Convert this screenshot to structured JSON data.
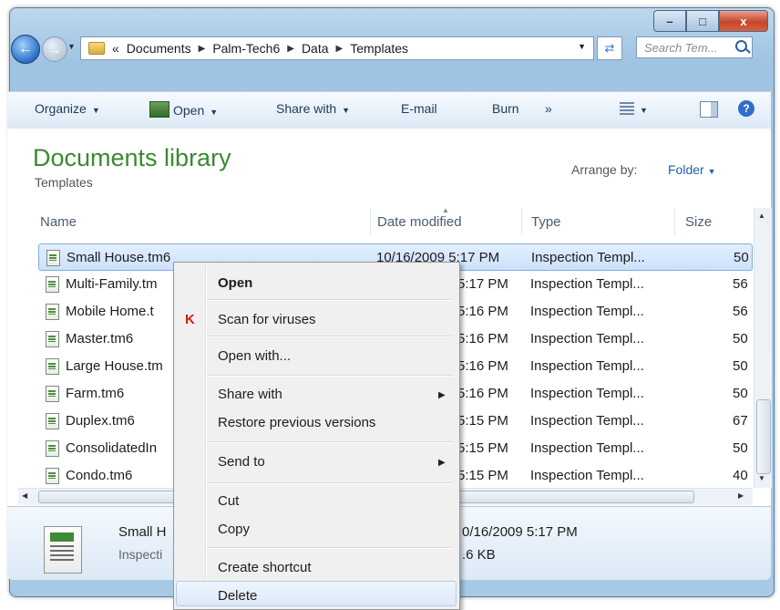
{
  "window": {
    "caption_buttons": [
      "–",
      "□",
      "x"
    ]
  },
  "address_bar": {
    "overflow": "«",
    "crumbs": [
      "Documents",
      "Palm-Tech6",
      "Data",
      "Templates"
    ],
    "search_placeholder": "Search Tem..."
  },
  "toolbar": {
    "organize": "Organize",
    "open": "Open",
    "share_with": "Share with",
    "email": "E-mail",
    "burn": "Burn",
    "more": "»"
  },
  "library": {
    "title": "Documents library",
    "subtitle": "Templates",
    "arrange_by_label": "Arrange by:",
    "arrange_by_value": "Folder"
  },
  "columns": {
    "name": "Name",
    "date": "Date modified",
    "type": "Type",
    "size": "Size"
  },
  "files": [
    {
      "name": "Small House.tm6",
      "date": "10/16/2009 5:17 PM",
      "type": "Inspection Templ...",
      "size": "50"
    },
    {
      "name": "Multi-Family.tm",
      "date": "5:17 PM",
      "type": "Inspection Templ...",
      "size": "56"
    },
    {
      "name": "Mobile Home.t",
      "date": "5:16 PM",
      "type": "Inspection Templ...",
      "size": "56"
    },
    {
      "name": "Master.tm6",
      "date": "5:16 PM",
      "type": "Inspection Templ...",
      "size": "50"
    },
    {
      "name": "Large House.tm",
      "date": "5:16 PM",
      "type": "Inspection Templ...",
      "size": "50"
    },
    {
      "name": "Farm.tm6",
      "date": "5:16 PM",
      "type": "Inspection Templ...",
      "size": "50"
    },
    {
      "name": "Duplex.tm6",
      "date": "5:15 PM",
      "type": "Inspection Templ...",
      "size": "67"
    },
    {
      "name": "ConsolidatedIn",
      "date": "5:15 PM",
      "type": "Inspection Templ...",
      "size": "50"
    },
    {
      "name": "Condo.tm6",
      "date": "5:15 PM",
      "type": "Inspection Templ...",
      "size": "40"
    }
  ],
  "details": {
    "name": "Small H",
    "type": "Inspecti",
    "date": "0/16/2009 5:17 PM",
    "size": ".6 KB"
  },
  "context_menu": {
    "open": "Open",
    "scan": "Scan for viruses",
    "open_with": "Open with...",
    "share_with": "Share with",
    "restore": "Restore previous versions",
    "send_to": "Send to",
    "cut": "Cut",
    "copy": "Copy",
    "create_shortcut": "Create shortcut",
    "delete": "Delete"
  },
  "colors": {
    "library_title": "#3a8a2f",
    "link": "#1f5fae",
    "selection": "#cce1fb"
  }
}
